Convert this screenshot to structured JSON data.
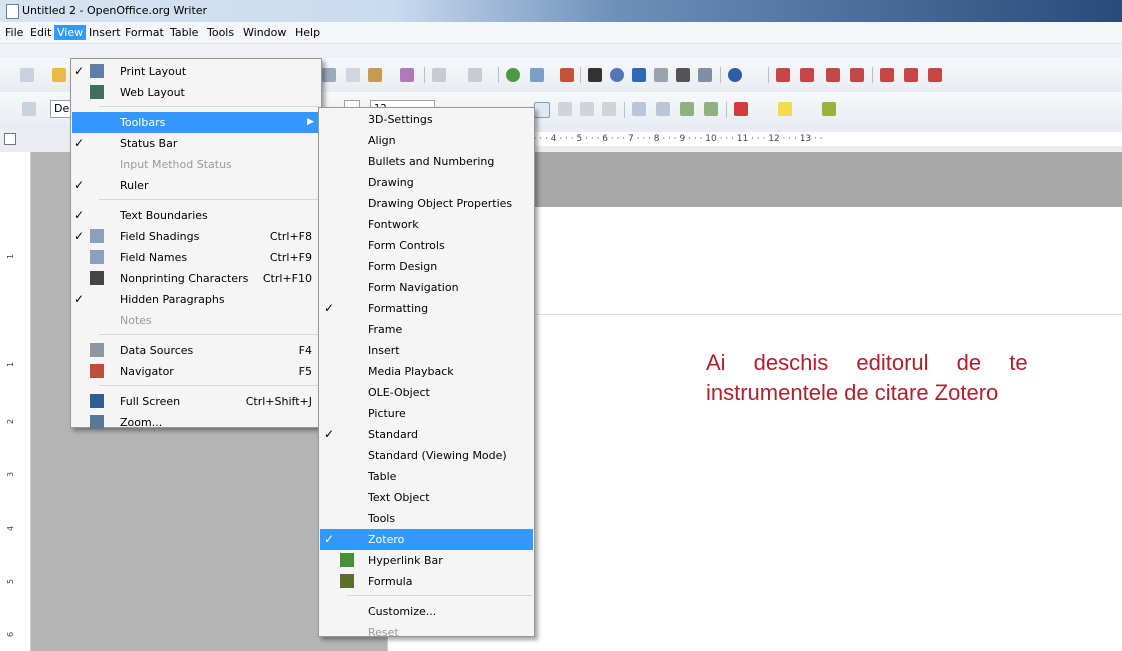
{
  "window": {
    "title": "Untitled 2 - OpenOffice.org Writer"
  },
  "menubar": [
    {
      "label": "File",
      "active": false
    },
    {
      "label": "Edit",
      "active": false
    },
    {
      "label": "View",
      "active": true
    },
    {
      "label": "Insert",
      "active": false
    },
    {
      "label": "Format",
      "active": false
    },
    {
      "label": "Table",
      "active": false
    },
    {
      "label": "Tools",
      "active": false
    },
    {
      "label": "Window",
      "active": false
    },
    {
      "label": "Help",
      "active": false
    }
  ],
  "toolbar_formatting": {
    "style_value": "De",
    "font_size": "12"
  },
  "ruler": {
    "labels": "3 · · · 4 · · · 5 · · · 6 · · · 7 · · · 8 · · · 9 · · · 10 · · · 11 · · · 12 · · · 13 · ·"
  },
  "vruler": [
    "1",
    "1",
    "2",
    "3",
    "4",
    "5",
    "6"
  ],
  "view_menu": {
    "items": [
      {
        "label": "Print Layout",
        "checked": true,
        "icon": "print-layout-icon"
      },
      {
        "label": "Web Layout",
        "checked": false,
        "icon": "web-layout-icon"
      },
      {
        "sep": true
      },
      {
        "label": "Toolbars",
        "submenu": true,
        "highlighted": true
      },
      {
        "label": "Status Bar",
        "checked": true
      },
      {
        "label": "Input Method Status",
        "disabled": true
      },
      {
        "label": "Ruler",
        "checked": true
      },
      {
        "sep": true
      },
      {
        "label": "Text Boundaries",
        "checked": true
      },
      {
        "label": "Field Shadings",
        "checked": true,
        "shortcut": "Ctrl+F8",
        "icon": "field-shadings-icon"
      },
      {
        "label": "Field Names",
        "shortcut": "Ctrl+F9",
        "icon": "field-names-icon"
      },
      {
        "label": "Nonprinting Characters",
        "shortcut": "Ctrl+F10",
        "icon": "pilcrow-icon"
      },
      {
        "label": "Hidden Paragraphs",
        "checked": true
      },
      {
        "label": "Notes",
        "disabled": true
      },
      {
        "sep": true
      },
      {
        "label": "Data Sources",
        "shortcut": "F4",
        "icon": "database-icon"
      },
      {
        "label": "Navigator",
        "shortcut": "F5",
        "icon": "compass-icon"
      },
      {
        "sep": true
      },
      {
        "label": "Full Screen",
        "shortcut": "Ctrl+Shift+J",
        "icon": "fullscreen-icon"
      },
      {
        "label": "Zoom...",
        "icon": "zoom-icon"
      }
    ]
  },
  "toolbars_submenu": {
    "items": [
      {
        "label": "3D-Settings"
      },
      {
        "label": "Align"
      },
      {
        "label": "Bullets and Numbering"
      },
      {
        "label": "Drawing"
      },
      {
        "label": "Drawing Object Properties"
      },
      {
        "label": "Fontwork"
      },
      {
        "label": "Form Controls"
      },
      {
        "label": "Form Design"
      },
      {
        "label": "Form Navigation"
      },
      {
        "label": "Formatting",
        "checked": true
      },
      {
        "label": "Frame"
      },
      {
        "label": "Insert"
      },
      {
        "label": "Media Playback"
      },
      {
        "label": "OLE-Object"
      },
      {
        "label": "Picture"
      },
      {
        "label": "Standard",
        "checked": true
      },
      {
        "label": "Standard (Viewing Mode)"
      },
      {
        "label": "Table"
      },
      {
        "label": "Text Object"
      },
      {
        "label": "Tools"
      },
      {
        "label": "Zotero",
        "checked": true,
        "highlighted": true
      },
      {
        "label": "Hyperlink Bar",
        "icon": "hyperlink-icon"
      },
      {
        "label": "Formula",
        "icon": "formula-icon"
      },
      {
        "sep": true
      },
      {
        "label": "Customize..."
      },
      {
        "label": "Reset",
        "disabled": true
      }
    ]
  },
  "overlay": {
    "line1": "Ai deschis editorul de te",
    "line2": "instrumentele de citare Zotero"
  },
  "colors": {
    "highlight": "#3399ff",
    "overlay_text": "#b0202c"
  }
}
